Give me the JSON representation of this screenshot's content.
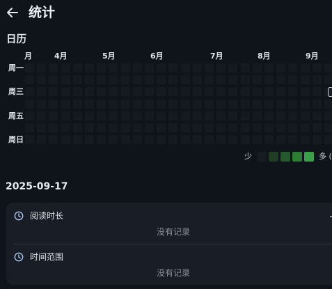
{
  "header": {
    "back_icon": "arrow-left-icon",
    "title": "统计"
  },
  "calendar": {
    "section_title": "日历",
    "months": [
      "月",
      "4月",
      "5月",
      "6月",
      "7月",
      "8月",
      "9月"
    ],
    "weekdays": [
      "周一",
      "周三",
      "周五",
      "周日"
    ],
    "weeks_visible": 32,
    "days_per_week": 7,
    "activity_levels": [],
    "legend": {
      "less_label": "少",
      "more_label": "多 (",
      "level_colors": [
        "#161b22",
        "#1f3d23",
        "#24592b",
        "#2d7c36",
        "#39a047"
      ]
    },
    "empty_cell_color": "#151a21"
  },
  "day_detail": {
    "date": "2025-09-17",
    "rows": [
      {
        "icon": "clock-icon",
        "label": "阅读时长",
        "value": "没有记录"
      },
      {
        "icon": "clock-icon",
        "label": "时间范围",
        "value": "没有记录"
      }
    ]
  },
  "colors": {
    "background": "#0f131a",
    "card": "#191e26",
    "accent_icon": "#a9c4ee"
  }
}
